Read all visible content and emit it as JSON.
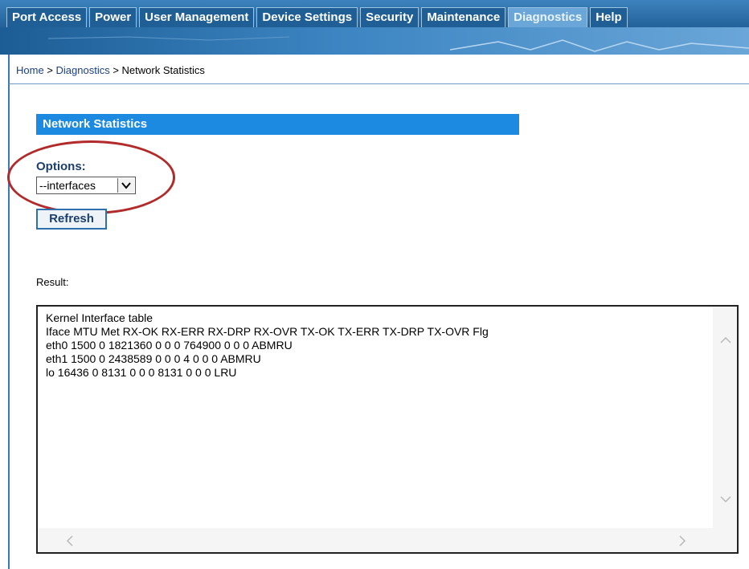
{
  "nav": {
    "tabs": [
      {
        "label": "Port Access"
      },
      {
        "label": "Power"
      },
      {
        "label": "User Management"
      },
      {
        "label": "Device Settings"
      },
      {
        "label": "Security"
      },
      {
        "label": "Maintenance"
      },
      {
        "label": "Diagnostics",
        "active": true
      },
      {
        "label": "Help"
      }
    ]
  },
  "breadcrumb": {
    "home": "Home",
    "sep1": " > ",
    "section": "Diagnostics",
    "sep2": " > ",
    "current": "Network Statistics"
  },
  "page": {
    "title": "Network Statistics",
    "options_label": "Options:",
    "options_value": "--interfaces",
    "refresh_label": "Refresh",
    "result_label": "Result:"
  },
  "result_lines": [
    "Kernel Interface table",
    "Iface MTU Met RX-OK RX-ERR RX-DRP RX-OVR TX-OK TX-ERR TX-DRP TX-OVR Flg",
    "eth0 1500 0 1821360 0 0 0 764900 0 0 0 ABMRU",
    "eth1 1500 0 2438589 0 0 0 4 0 0 0 ABMRU",
    "lo 16436 0 8131 0 0 0 8131 0 0 0 LRU"
  ],
  "colors": {
    "nav_bg": "#2a6fa6",
    "title_bar": "#1b8ae0",
    "highlight_circle": "#b22a2a"
  }
}
